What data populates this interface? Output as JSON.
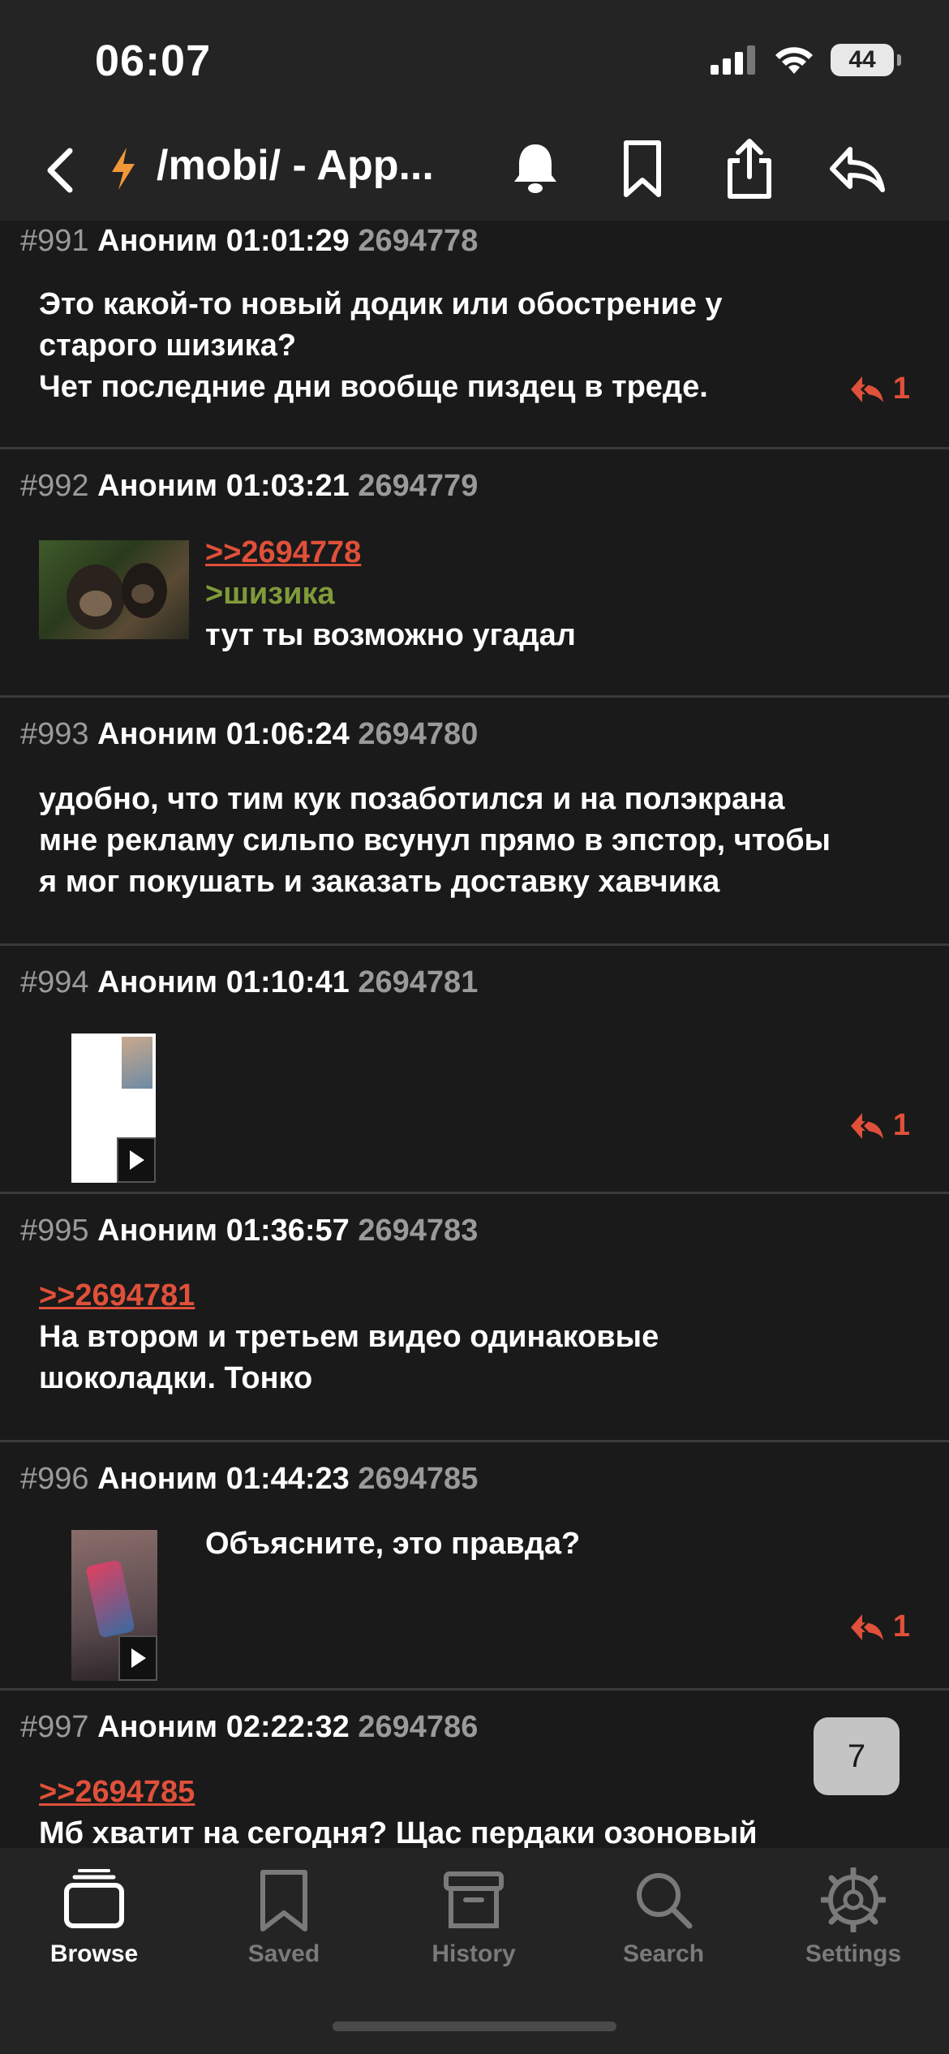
{
  "status_bar": {
    "time": "06:07",
    "battery": "44"
  },
  "nav": {
    "title": "/mobi/ - App..."
  },
  "posts": [
    {
      "num": "#991",
      "name": "Аноним",
      "time": "01:01:29",
      "id": "2694778",
      "lines": [
        "Это какой-то новый додик или обострение у",
        "старого шизика?",
        "Чет последние дни вообще пиздец в треде."
      ],
      "replies": "1"
    },
    {
      "num": "#992",
      "name": "Аноним",
      "time": "01:03:21",
      "id": "2694779",
      "link": ">>2694778",
      "quote": ">шизика",
      "lines": [
        "тут ты возможно угадал"
      ]
    },
    {
      "num": "#993",
      "name": "Аноним",
      "time": "01:06:24",
      "id": "2694780",
      "lines": [
        "удобно, что тим кук позаботился и на полэкрана",
        "мне рекламу сильпо всунул прямо в эпстор, чтобы",
        "я мог покушать и заказать доставку хавчика"
      ]
    },
    {
      "num": "#994",
      "name": "Аноним",
      "time": "01:10:41",
      "id": "2694781",
      "replies": "1"
    },
    {
      "num": "#995",
      "name": "Аноним",
      "time": "01:36:57",
      "id": "2694783",
      "link": ">>2694781",
      "lines": [
        "На втором и третьем видео одинаковые",
        "шоколадки. Тонко"
      ]
    },
    {
      "num": "#996",
      "name": "Аноним",
      "time": "01:44:23",
      "id": "2694785",
      "lines": [
        "Объясните, это правда?"
      ],
      "replies": "1"
    },
    {
      "num": "#997",
      "name": "Аноним",
      "time": "02:22:32",
      "id": "2694786",
      "link": ">>2694785",
      "lines": [
        "Мб хватит на сегодня? Щас пердаки озоновый"
      ]
    }
  ],
  "fab": {
    "count": "7"
  },
  "tabs": [
    {
      "label": "Browse",
      "icon": "browse-icon",
      "active": true
    },
    {
      "label": "Saved",
      "icon": "bookmark-icon"
    },
    {
      "label": "History",
      "icon": "archive-icon"
    },
    {
      "label": "Search",
      "icon": "search-icon"
    },
    {
      "label": "Settings",
      "icon": "gear-icon"
    }
  ],
  "colors": {
    "accent": "#e0503a",
    "quote": "#7f9b3a",
    "background": "#1a1a1a",
    "bar": "#242424"
  }
}
